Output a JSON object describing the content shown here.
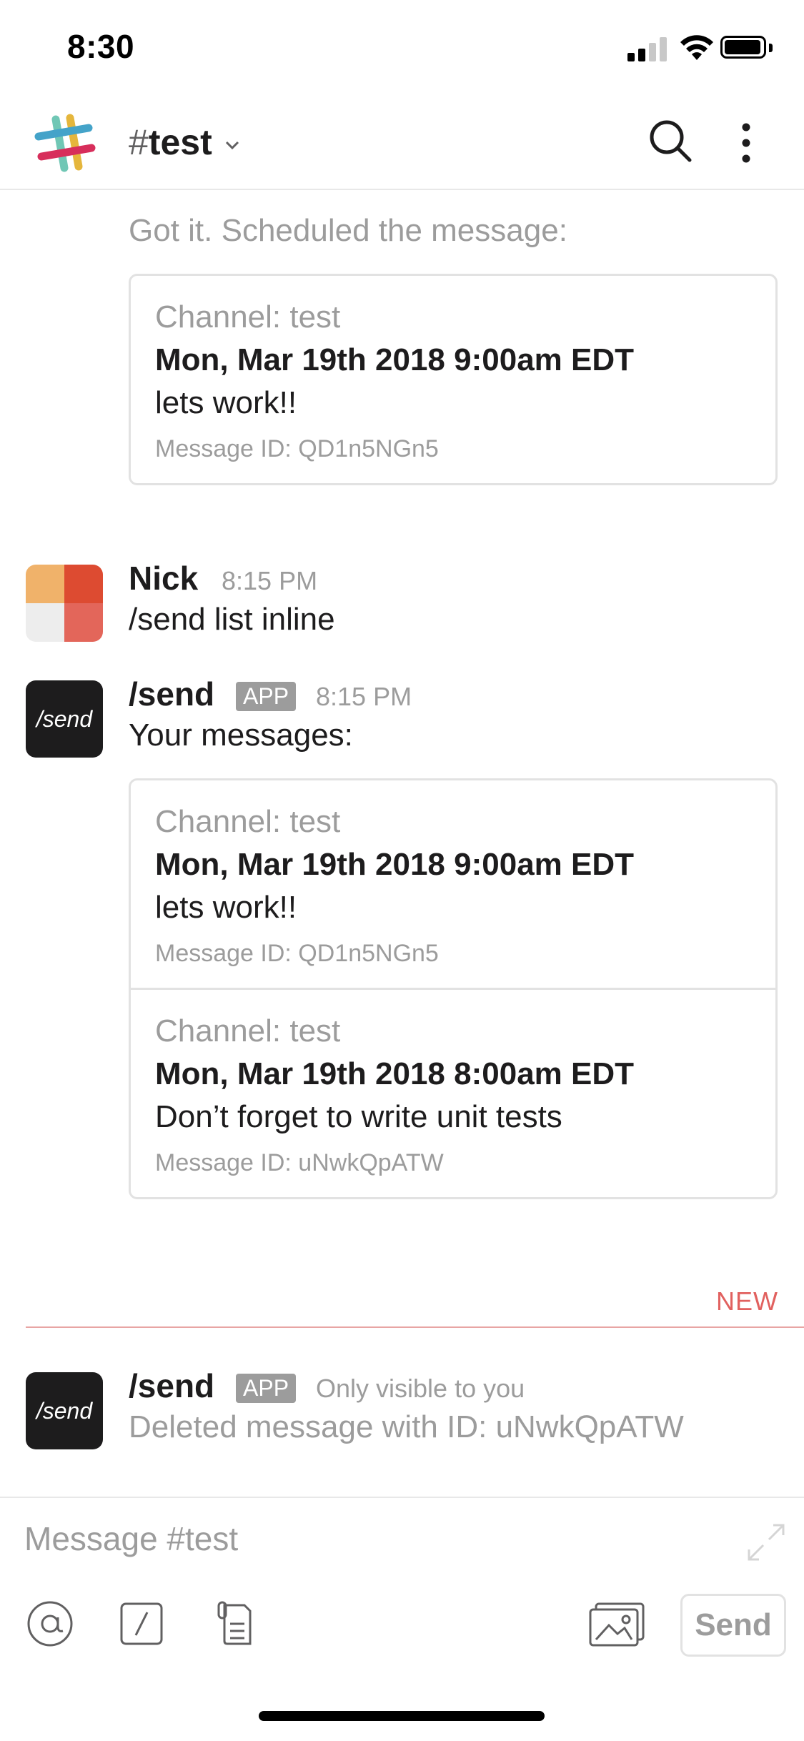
{
  "status_bar": {
    "time": "8:30"
  },
  "header": {
    "hash": "#",
    "channel": "test"
  },
  "scheduled_note": {
    "text": "Got it. Scheduled the message:",
    "card": {
      "channel": "Channel: test",
      "date": "Mon, Mar 19th 2018 9:00am EDT",
      "text": "lets work!!",
      "id": "Message ID: QD1n5NGn5"
    }
  },
  "messages": [
    {
      "sender": "Nick",
      "time": "8:15 PM",
      "text": "/send list inline"
    },
    {
      "sender": "/send",
      "badge": "APP",
      "time": "8:15 PM",
      "text": "Your messages:",
      "avatar_text": "/send",
      "cards": [
        {
          "channel": "Channel: test",
          "date": "Mon, Mar 19th 2018 9:00am EDT",
          "text": "lets work!!",
          "id": "Message ID: QD1n5NGn5"
        },
        {
          "channel": "Channel: test",
          "date": "Mon, Mar 19th 2018 8:00am EDT",
          "text": "Don’t forget to write unit tests",
          "id": "Message ID: uNwkQpATW"
        }
      ]
    },
    {
      "sender": "/send",
      "badge": "APP",
      "visibility": "Only visible to you",
      "text": "Deleted message with ID: uNwkQpATW",
      "avatar_text": "/send"
    }
  ],
  "new_divider": "NEW",
  "composer": {
    "placeholder": "Message #test",
    "send_label": "Send"
  },
  "colors": {
    "accent_new": "#e1615f",
    "text_primary": "#1d1c1d",
    "text_muted": "#9c9c9c",
    "app_badge": "#9c9c9c"
  },
  "icons": [
    "slack-logo-icon",
    "chevron-down-icon",
    "search-icon",
    "more-vertical-icon",
    "at-icon",
    "slash-command-icon",
    "file-icon",
    "photo-icon",
    "expand-icon"
  ]
}
